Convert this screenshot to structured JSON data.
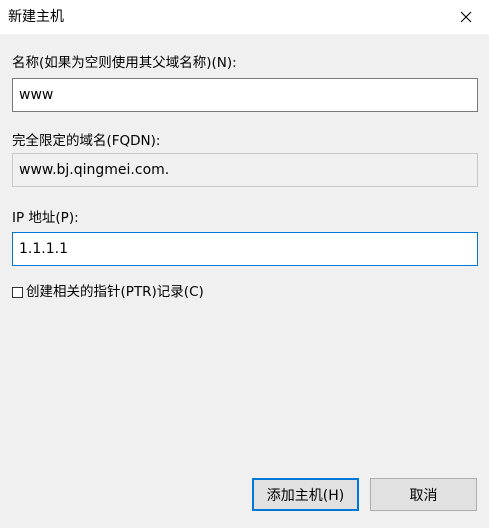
{
  "dialog": {
    "title": "新建主机"
  },
  "form": {
    "name_label": "名称(如果为空则使用其父域名称)(N):",
    "name_value": "www",
    "fqdn_label": "完全限定的域名(FQDN):",
    "fqdn_value": "www.bj.qingmei.com.",
    "ip_label": "IP 地址(P):",
    "ip_value": "1.1.1.1",
    "ptr_checkbox_label": "创建相关的指针(PTR)记录(C)",
    "ptr_checked": false
  },
  "buttons": {
    "add_label": "添加主机(H)",
    "cancel_label": "取消"
  },
  "colors": {
    "focus_accent": "#0078d7",
    "background": "#f0f0f0"
  }
}
